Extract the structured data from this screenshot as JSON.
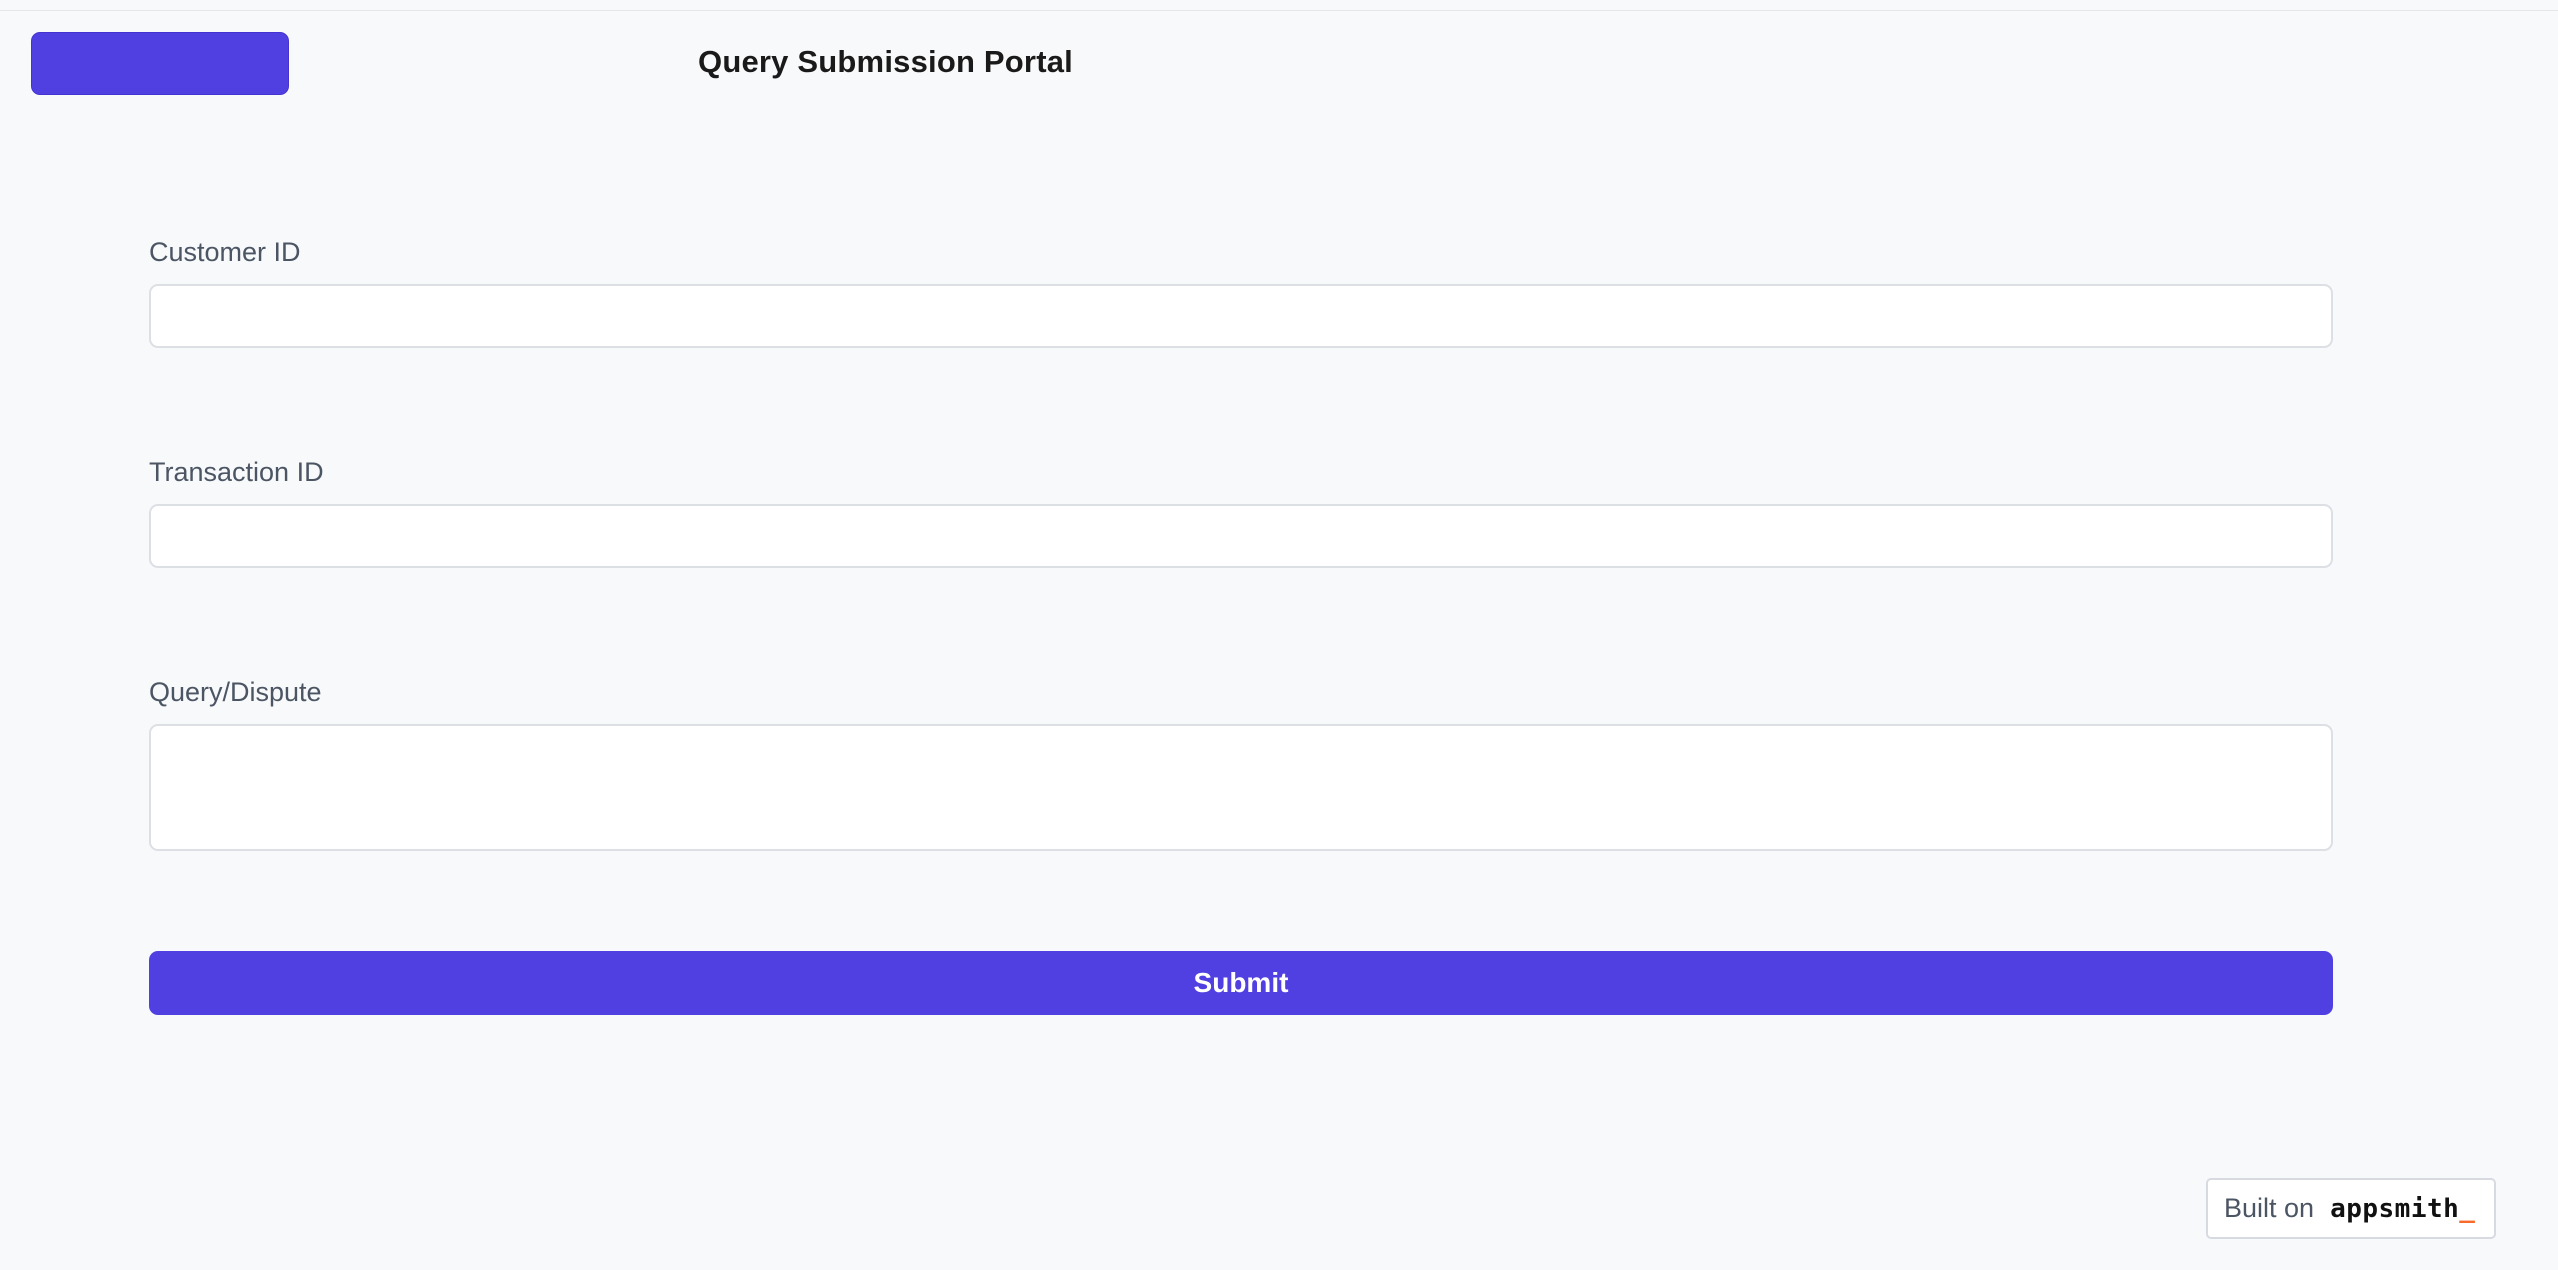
{
  "header": {
    "title": "Query Submission Portal",
    "nav_button_label": ""
  },
  "form": {
    "customer_id": {
      "label": "Customer ID",
      "value": "",
      "placeholder": ""
    },
    "transaction_id": {
      "label": "Transaction ID",
      "value": "",
      "placeholder": ""
    },
    "query_dispute": {
      "label": "Query/Dispute",
      "value": "",
      "placeholder": ""
    },
    "submit_label": "Submit"
  },
  "footer": {
    "built_on_text": "Built on",
    "brand_name": "appsmith",
    "brand_cursor": "_"
  },
  "colors": {
    "accent": "#5040e2",
    "background": "#f8f9fb",
    "brand_cursor": "#f86a2b"
  }
}
